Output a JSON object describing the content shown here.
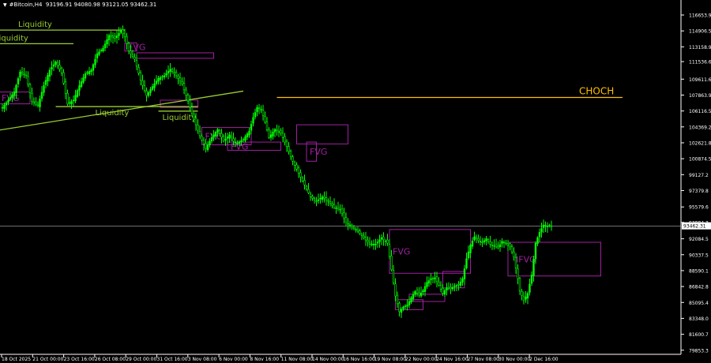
{
  "header": {
    "symbol": "#Bitcoin,H4",
    "ohlc": "93196.91 94080.98 93121.05 93462.31"
  },
  "colors": {
    "bg": "#000000",
    "candle": "#00ff00",
    "fvg": "#a020a0",
    "liquidity": "#9acd32",
    "choch": "#ffc000",
    "axis": "#ffffff",
    "price_line": "#b4b4b4"
  },
  "chart_data": {
    "type": "candlestick",
    "x_tick_labels": [
      "18 Oct 2025",
      "21 Oct 00:00",
      "23 Oct 16:00",
      "26 Oct 08:00",
      "29 Oct 00:00",
      "31 Oct 16:00",
      "3 Nov 08:00",
      "6 Nov 00:00",
      "8 Nov 16:00",
      "11 Nov 08:00",
      "14 Nov 00:00",
      "16 Nov 16:00",
      "19 Nov 08:00",
      "22 Nov 00:00",
      "24 Nov 16:00",
      "27 Nov 08:00",
      "30 Nov 00:00",
      "2 Dec 16:00"
    ],
    "y_ticks": [
      116653.9,
      114906.5,
      113158.9,
      111536.6,
      109611.6,
      107863.9,
      106116.5,
      104369.2,
      102621.8,
      100874.5,
      99127.2,
      97379.8,
      95579.6,
      93884.3,
      92084.5,
      90337.5,
      88590.1,
      86842.8,
      85095.4,
      83348.0,
      81600.7,
      79853.3
    ],
    "y_range": [
      79400,
      118300
    ],
    "current_price": 93462.31,
    "current_price_label": "93462.31",
    "close_path": [
      [
        0,
        106500
      ],
      [
        3,
        107300
      ],
      [
        6,
        108200
      ],
      [
        9,
        110400
      ],
      [
        12,
        110000
      ],
      [
        15,
        107200
      ],
      [
        18,
        106700
      ],
      [
        21,
        108900
      ],
      [
        24,
        110600
      ],
      [
        27,
        111500
      ],
      [
        30,
        110300
      ],
      [
        33,
        106900
      ],
      [
        36,
        107300
      ],
      [
        39,
        108900
      ],
      [
        42,
        110200
      ],
      [
        45,
        110600
      ],
      [
        48,
        112400
      ],
      [
        51,
        113000
      ],
      [
        54,
        114400
      ],
      [
        57,
        114100
      ],
      [
        60,
        114900
      ],
      [
        62,
        114300
      ],
      [
        64,
        112700
      ],
      [
        67,
        111800
      ],
      [
        70,
        109500
      ],
      [
        73,
        107800
      ],
      [
        76,
        108800
      ],
      [
        79,
        109700
      ],
      [
        82,
        110000
      ],
      [
        85,
        110700
      ],
      [
        88,
        110000
      ],
      [
        91,
        109100
      ],
      [
        94,
        107200
      ],
      [
        97,
        105200
      ],
      [
        100,
        103400
      ],
      [
        103,
        102000
      ],
      [
        106,
        103200
      ],
      [
        109,
        104100
      ],
      [
        112,
        102800
      ],
      [
        115,
        103500
      ],
      [
        117,
        102800
      ],
      [
        119,
        102600
      ],
      [
        122,
        103000
      ],
      [
        125,
        103900
      ],
      [
        127,
        105400
      ],
      [
        129,
        106500
      ],
      [
        131,
        106300
      ],
      [
        133,
        104900
      ],
      [
        135,
        103200
      ],
      [
        138,
        104100
      ],
      [
        141,
        103700
      ],
      [
        144,
        102200
      ],
      [
        147,
        100600
      ],
      [
        150,
        99300
      ],
      [
        153,
        98000
      ],
      [
        156,
        96700
      ],
      [
        159,
        96200
      ],
      [
        162,
        96700
      ],
      [
        165,
        96200
      ],
      [
        168,
        95500
      ],
      [
        171,
        95300
      ],
      [
        174,
        93900
      ],
      [
        177,
        93400
      ],
      [
        180,
        92900
      ],
      [
        183,
        92200
      ],
      [
        186,
        91500
      ],
      [
        189,
        91500
      ],
      [
        192,
        92200
      ],
      [
        195,
        91600
      ],
      [
        197,
        88700
      ],
      [
        199,
        85800
      ],
      [
        201,
        84100
      ],
      [
        203,
        84600
      ],
      [
        205,
        84800
      ],
      [
        207,
        85600
      ],
      [
        209,
        86300
      ],
      [
        211,
        85900
      ],
      [
        213,
        86400
      ],
      [
        215,
        87300
      ],
      [
        217,
        87700
      ],
      [
        219,
        87800
      ],
      [
        221,
        87000
      ],
      [
        223,
        86100
      ],
      [
        225,
        86700
      ],
      [
        227,
        86600
      ],
      [
        229,
        86900
      ],
      [
        231,
        87000
      ],
      [
        233,
        87700
      ],
      [
        235,
        89900
      ],
      [
        237,
        91400
      ],
      [
        239,
        92300
      ],
      [
        241,
        91900
      ],
      [
        243,
        91700
      ],
      [
        245,
        92100
      ],
      [
        247,
        91500
      ],
      [
        249,
        91300
      ],
      [
        251,
        91100
      ],
      [
        253,
        91800
      ],
      [
        255,
        91600
      ],
      [
        257,
        91200
      ],
      [
        259,
        90100
      ],
      [
        261,
        87700
      ],
      [
        262,
        86400
      ],
      [
        264,
        85300
      ],
      [
        266,
        86100
      ],
      [
        268,
        88100
      ],
      [
        270,
        91600
      ],
      [
        272,
        92800
      ],
      [
        274,
        93600
      ],
      [
        276,
        93500
      ],
      [
        278,
        93462
      ]
    ],
    "zones": [
      {
        "label": "FVG",
        "price_top": 108200,
        "price_bottom": 106900,
        "from_bar": -2,
        "to_bar": 14
      },
      {
        "label": "FVG",
        "price_top": 113600,
        "price_bottom": 112700,
        "from_bar": 62,
        "to_bar": 68
      },
      {
        "label": "",
        "price_top": 112500,
        "price_bottom": 111900,
        "from_bar": 68,
        "to_bar": 107
      },
      {
        "label": "",
        "price_top": 107300,
        "price_bottom": 106500,
        "from_bar": 80,
        "to_bar": 99
      },
      {
        "label": "FVG",
        "price_top": 104300,
        "price_bottom": 102400,
        "from_bar": 101,
        "to_bar": 126
      },
      {
        "label": "FVG",
        "price_top": 102700,
        "price_bottom": 101800,
        "from_bar": 114,
        "to_bar": 141
      },
      {
        "label": "",
        "price_top": 104600,
        "price_bottom": 102500,
        "from_bar": 149,
        "to_bar": 175
      },
      {
        "label": "FVG",
        "price_top": 102700,
        "price_bottom": 100600,
        "from_bar": 154,
        "to_bar": 159
      },
      {
        "label": "FVG",
        "price_top": 93100,
        "price_bottom": 88300,
        "from_bar": 196,
        "to_bar": 237
      },
      {
        "label": "",
        "price_top": 88500,
        "price_bottom": 86700,
        "from_bar": 223,
        "to_bar": 234
      },
      {
        "label": "",
        "price_top": 86000,
        "price_bottom": 85200,
        "from_bar": 206,
        "to_bar": 224
      },
      {
        "label": "",
        "price_top": 85400,
        "price_bottom": 84300,
        "from_bar": 199,
        "to_bar": 213
      },
      {
        "label": "IFVG",
        "price_top": 91700,
        "price_bottom": 88000,
        "from_bar": 256,
        "to_bar": 303
      }
    ],
    "levels": [
      {
        "label": "Liquidity",
        "price": 115000,
        "from_bar": -2,
        "to_bar": 62,
        "label_at_bar": 8,
        "label_pos": "above"
      },
      {
        "label": "Liquidity",
        "price": 113500,
        "from_bar": -2,
        "to_bar": 36,
        "label_at_bar": -4,
        "label_pos": "above"
      },
      {
        "label": "Liquidity",
        "price": 106600,
        "from_bar": 27,
        "to_bar": 99,
        "label_at_bar": 47,
        "label_pos": "below"
      },
      {
        "label": "Liquidity",
        "price": 106100,
        "from_bar": 79,
        "to_bar": 99,
        "label_at_bar": 81,
        "label_pos": "below"
      },
      {
        "label": "CHOCH",
        "price": 107600,
        "from_bar": 139,
        "to_bar": 314,
        "label_at_bar": 292,
        "label_pos": "above"
      }
    ],
    "trendline": {
      "from_bar": -2,
      "from_price": 104000,
      "to_bar": 122,
      "to_price": 108300
    }
  }
}
